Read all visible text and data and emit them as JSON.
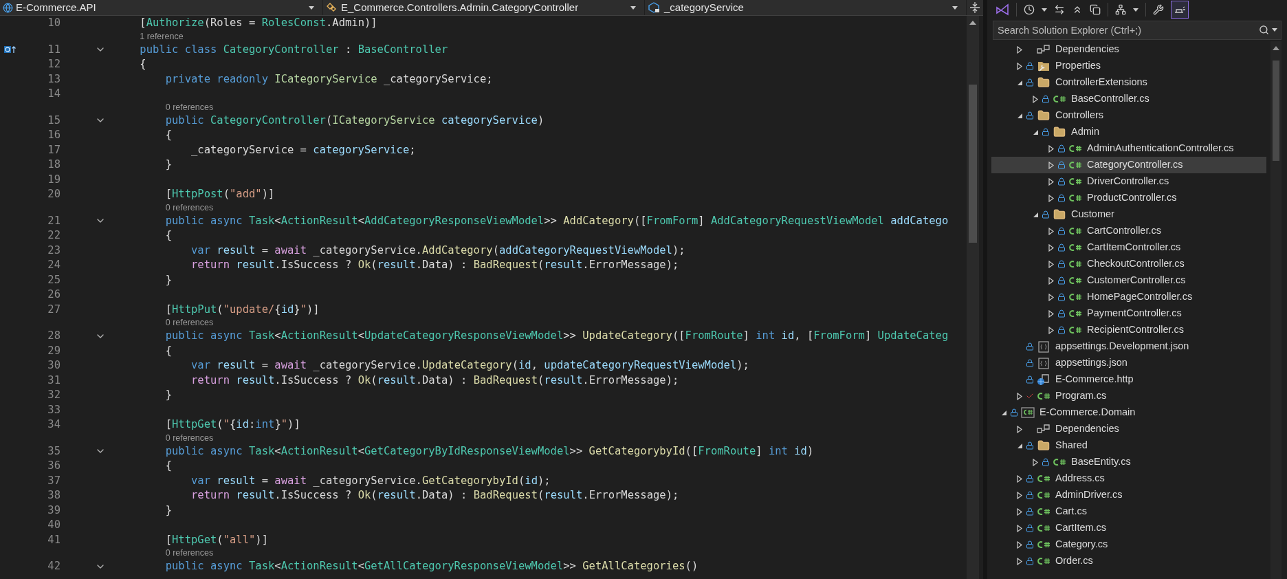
{
  "navigation_bar": [
    {
      "kind": "project",
      "text": "E-Commerce.API"
    },
    {
      "kind": "class",
      "text": "E_Commerce.Controllers.Admin.CategoryController"
    },
    {
      "kind": "member",
      "text": "_categoryService"
    }
  ],
  "editor": {
    "rows": [
      {
        "kind": "code",
        "number": "10",
        "foldable": false,
        "marker": false,
        "tokens": [
          {
            "kind": "plain",
            "text": "    ["
          },
          {
            "kind": "type",
            "text": "Authorize"
          },
          {
            "kind": "plain",
            "text": "(Roles = "
          },
          {
            "kind": "type",
            "text": "RolesConst"
          },
          {
            "kind": "plain",
            "text": ".Admin)]"
          }
        ]
      },
      {
        "kind": "codelens",
        "text": "1 reference"
      },
      {
        "kind": "code",
        "number": "11",
        "foldable": true,
        "marker": true,
        "tokens": [
          {
            "kind": "keyword",
            "text": "    public class "
          },
          {
            "kind": "type",
            "text": "CategoryController"
          },
          {
            "kind": "plain",
            "text": " : "
          },
          {
            "kind": "type",
            "text": "BaseController"
          }
        ]
      },
      {
        "kind": "code",
        "number": "12",
        "foldable": false,
        "marker": false,
        "tokens": [
          {
            "kind": "plain",
            "text": "    {"
          }
        ]
      },
      {
        "kind": "code",
        "number": "13",
        "foldable": false,
        "marker": false,
        "tokens": [
          {
            "kind": "keyword",
            "text": "        private readonly "
          },
          {
            "kind": "interface",
            "text": "ICategoryService"
          },
          {
            "kind": "plain",
            "text": " _categoryService;"
          }
        ]
      },
      {
        "kind": "code",
        "number": "14",
        "foldable": false,
        "marker": false
      },
      {
        "kind": "codelens",
        "text": "0 references"
      },
      {
        "kind": "code",
        "number": "15",
        "foldable": true,
        "marker": false,
        "tokens": [
          {
            "kind": "keyword",
            "text": "        public "
          },
          {
            "kind": "type",
            "text": "CategoryController"
          },
          {
            "kind": "plain",
            "text": "("
          },
          {
            "kind": "interface",
            "text": "ICategoryService"
          },
          {
            "kind": "variable",
            "text": " categoryService"
          },
          {
            "kind": "plain",
            "text": ")"
          }
        ]
      },
      {
        "kind": "code",
        "number": "16",
        "foldable": false,
        "marker": false,
        "tokens": [
          {
            "kind": "plain",
            "text": "        {"
          }
        ]
      },
      {
        "kind": "code",
        "number": "17",
        "foldable": false,
        "marker": false,
        "tokens": [
          {
            "kind": "plain",
            "text": "            _categoryService = "
          },
          {
            "kind": "variable",
            "text": "categoryService"
          },
          {
            "kind": "plain",
            "text": ";"
          }
        ]
      },
      {
        "kind": "code",
        "number": "18",
        "foldable": false,
        "marker": false,
        "tokens": [
          {
            "kind": "plain",
            "text": "        }"
          }
        ]
      },
      {
        "kind": "code",
        "number": "19",
        "foldable": false,
        "marker": false
      },
      {
        "kind": "code",
        "number": "20",
        "foldable": false,
        "marker": false,
        "tokens": [
          {
            "kind": "plain",
            "text": "        ["
          },
          {
            "kind": "type",
            "text": "HttpPost"
          },
          {
            "kind": "plain",
            "text": "("
          },
          {
            "kind": "string",
            "text": "\"add\""
          },
          {
            "kind": "plain",
            "text": ")]"
          }
        ]
      },
      {
        "kind": "codelens",
        "text": "0 references"
      },
      {
        "kind": "code",
        "number": "21",
        "foldable": true,
        "marker": false,
        "tokens": [
          {
            "kind": "keyword",
            "text": "        public async "
          },
          {
            "kind": "type",
            "text": "Task"
          },
          {
            "kind": "plain",
            "text": "<"
          },
          {
            "kind": "type",
            "text": "ActionResult"
          },
          {
            "kind": "plain",
            "text": "<"
          },
          {
            "kind": "type",
            "text": "AddCategoryResponseViewModel"
          },
          {
            "kind": "plain",
            "text": ">> "
          },
          {
            "kind": "method",
            "text": "AddCategory"
          },
          {
            "kind": "plain",
            "text": "(["
          },
          {
            "kind": "type",
            "text": "FromForm"
          },
          {
            "kind": "plain",
            "text": "] "
          },
          {
            "kind": "type",
            "text": "AddCategoryRequestViewModel"
          },
          {
            "kind": "variable",
            "text": " addCatego"
          }
        ]
      },
      {
        "kind": "code",
        "number": "22",
        "foldable": false,
        "marker": false,
        "tokens": [
          {
            "kind": "plain",
            "text": "        {"
          }
        ]
      },
      {
        "kind": "code",
        "number": "23",
        "foldable": false,
        "marker": false,
        "tokens": [
          {
            "kind": "keyword",
            "text": "            var "
          },
          {
            "kind": "variable",
            "text": "result"
          },
          {
            "kind": "plain",
            "text": " = "
          },
          {
            "kind": "control",
            "text": "await"
          },
          {
            "kind": "plain",
            "text": " _categoryService."
          },
          {
            "kind": "method",
            "text": "AddCategory"
          },
          {
            "kind": "plain",
            "text": "("
          },
          {
            "kind": "variable",
            "text": "addCategoryRequestViewModel"
          },
          {
            "kind": "plain",
            "text": ");"
          }
        ]
      },
      {
        "kind": "code",
        "number": "24",
        "foldable": false,
        "marker": false,
        "tokens": [
          {
            "kind": "control",
            "text": "            return "
          },
          {
            "kind": "variable",
            "text": "result"
          },
          {
            "kind": "plain",
            "text": ".IsSuccess ? "
          },
          {
            "kind": "method",
            "text": "Ok"
          },
          {
            "kind": "plain",
            "text": "("
          },
          {
            "kind": "variable",
            "text": "result"
          },
          {
            "kind": "plain",
            "text": ".Data) : "
          },
          {
            "kind": "method",
            "text": "BadRequest"
          },
          {
            "kind": "plain",
            "text": "("
          },
          {
            "kind": "variable",
            "text": "result"
          },
          {
            "kind": "plain",
            "text": ".ErrorMessage);"
          }
        ]
      },
      {
        "kind": "code",
        "number": "25",
        "foldable": false,
        "marker": false,
        "tokens": [
          {
            "kind": "plain",
            "text": "        }"
          }
        ]
      },
      {
        "kind": "code",
        "number": "26",
        "foldable": false,
        "marker": false
      },
      {
        "kind": "code",
        "number": "27",
        "foldable": false,
        "marker": false,
        "tokens": [
          {
            "kind": "plain",
            "text": "        ["
          },
          {
            "kind": "type",
            "text": "HttpPut"
          },
          {
            "kind": "plain",
            "text": "("
          },
          {
            "kind": "string",
            "text": "\"update/"
          },
          {
            "kind": "plain",
            "text": "{"
          },
          {
            "kind": "variable",
            "text": "id"
          },
          {
            "kind": "plain",
            "text": "}"
          },
          {
            "kind": "string",
            "text": "\""
          },
          {
            "kind": "plain",
            "text": ")]"
          }
        ]
      },
      {
        "kind": "codelens",
        "text": "0 references"
      },
      {
        "kind": "code",
        "number": "28",
        "foldable": true,
        "marker": false,
        "tokens": [
          {
            "kind": "keyword",
            "text": "        public async "
          },
          {
            "kind": "type",
            "text": "Task"
          },
          {
            "kind": "plain",
            "text": "<"
          },
          {
            "kind": "type",
            "text": "ActionResult"
          },
          {
            "kind": "plain",
            "text": "<"
          },
          {
            "kind": "type",
            "text": "UpdateCategoryResponseViewModel"
          },
          {
            "kind": "plain",
            "text": ">> "
          },
          {
            "kind": "method",
            "text": "UpdateCategory"
          },
          {
            "kind": "plain",
            "text": "(["
          },
          {
            "kind": "type",
            "text": "FromRoute"
          },
          {
            "kind": "plain",
            "text": "] "
          },
          {
            "kind": "keyword",
            "text": "int "
          },
          {
            "kind": "variable",
            "text": "id"
          },
          {
            "kind": "plain",
            "text": ", ["
          },
          {
            "kind": "type",
            "text": "FromForm"
          },
          {
            "kind": "plain",
            "text": "] "
          },
          {
            "kind": "type",
            "text": "UpdateCateg"
          }
        ]
      },
      {
        "kind": "code",
        "number": "29",
        "foldable": false,
        "marker": false,
        "tokens": [
          {
            "kind": "plain",
            "text": "        {"
          }
        ]
      },
      {
        "kind": "code",
        "number": "30",
        "foldable": false,
        "marker": false,
        "tokens": [
          {
            "kind": "keyword",
            "text": "            var "
          },
          {
            "kind": "variable",
            "text": "result"
          },
          {
            "kind": "plain",
            "text": " = "
          },
          {
            "kind": "control",
            "text": "await"
          },
          {
            "kind": "plain",
            "text": " _categoryService."
          },
          {
            "kind": "method",
            "text": "UpdateCategory"
          },
          {
            "kind": "plain",
            "text": "("
          },
          {
            "kind": "variable",
            "text": "id"
          },
          {
            "kind": "plain",
            "text": ", "
          },
          {
            "kind": "variable",
            "text": "updateCategoryRequestViewModel"
          },
          {
            "kind": "plain",
            "text": ");"
          }
        ]
      },
      {
        "kind": "code",
        "number": "31",
        "foldable": false,
        "marker": false,
        "tokens": [
          {
            "kind": "control",
            "text": "            return "
          },
          {
            "kind": "variable",
            "text": "result"
          },
          {
            "kind": "plain",
            "text": ".IsSuccess ? "
          },
          {
            "kind": "method",
            "text": "Ok"
          },
          {
            "kind": "plain",
            "text": "("
          },
          {
            "kind": "variable",
            "text": "result"
          },
          {
            "kind": "plain",
            "text": ".Data) : "
          },
          {
            "kind": "method",
            "text": "BadRequest"
          },
          {
            "kind": "plain",
            "text": "("
          },
          {
            "kind": "variable",
            "text": "result"
          },
          {
            "kind": "plain",
            "text": ".ErrorMessage);"
          }
        ]
      },
      {
        "kind": "code",
        "number": "32",
        "foldable": false,
        "marker": false,
        "tokens": [
          {
            "kind": "plain",
            "text": "        }"
          }
        ]
      },
      {
        "kind": "code",
        "number": "33",
        "foldable": false,
        "marker": false
      },
      {
        "kind": "code",
        "number": "34",
        "foldable": false,
        "marker": false,
        "tokens": [
          {
            "kind": "plain",
            "text": "        ["
          },
          {
            "kind": "type",
            "text": "HttpGet"
          },
          {
            "kind": "plain",
            "text": "("
          },
          {
            "kind": "string",
            "text": "\""
          },
          {
            "kind": "plain",
            "text": "{"
          },
          {
            "kind": "variable",
            "text": "id"
          },
          {
            "kind": "plain",
            "text": ":"
          },
          {
            "kind": "keyword",
            "text": "int"
          },
          {
            "kind": "plain",
            "text": "}"
          },
          {
            "kind": "string",
            "text": "\""
          },
          {
            "kind": "plain",
            "text": ")]"
          }
        ]
      },
      {
        "kind": "codelens",
        "text": "0 references"
      },
      {
        "kind": "code",
        "number": "35",
        "foldable": true,
        "marker": false,
        "tokens": [
          {
            "kind": "keyword",
            "text": "        public async "
          },
          {
            "kind": "type",
            "text": "Task"
          },
          {
            "kind": "plain",
            "text": "<"
          },
          {
            "kind": "type",
            "text": "ActionResult"
          },
          {
            "kind": "plain",
            "text": "<"
          },
          {
            "kind": "type",
            "text": "GetCategoryByIdResponseViewModel"
          },
          {
            "kind": "plain",
            "text": ">> "
          },
          {
            "kind": "method",
            "text": "GetCategorybyId"
          },
          {
            "kind": "plain",
            "text": "(["
          },
          {
            "kind": "type",
            "text": "FromRoute"
          },
          {
            "kind": "plain",
            "text": "] "
          },
          {
            "kind": "keyword",
            "text": "int "
          },
          {
            "kind": "variable",
            "text": "id"
          },
          {
            "kind": "plain",
            "text": ")"
          }
        ]
      },
      {
        "kind": "code",
        "number": "36",
        "foldable": false,
        "marker": false,
        "tokens": [
          {
            "kind": "plain",
            "text": "        {"
          }
        ]
      },
      {
        "kind": "code",
        "number": "37",
        "foldable": false,
        "marker": false,
        "tokens": [
          {
            "kind": "keyword",
            "text": "            var "
          },
          {
            "kind": "variable",
            "text": "result"
          },
          {
            "kind": "plain",
            "text": " = "
          },
          {
            "kind": "control",
            "text": "await"
          },
          {
            "kind": "plain",
            "text": " _categoryService."
          },
          {
            "kind": "method",
            "text": "GetCategorybyId"
          },
          {
            "kind": "plain",
            "text": "("
          },
          {
            "kind": "variable",
            "text": "id"
          },
          {
            "kind": "plain",
            "text": ");"
          }
        ]
      },
      {
        "kind": "code",
        "number": "38",
        "foldable": false,
        "marker": false,
        "tokens": [
          {
            "kind": "control",
            "text": "            return "
          },
          {
            "kind": "variable",
            "text": "result"
          },
          {
            "kind": "plain",
            "text": ".IsSuccess ? "
          },
          {
            "kind": "method",
            "text": "Ok"
          },
          {
            "kind": "plain",
            "text": "("
          },
          {
            "kind": "variable",
            "text": "result"
          },
          {
            "kind": "plain",
            "text": ".Data) : "
          },
          {
            "kind": "method",
            "text": "BadRequest"
          },
          {
            "kind": "plain",
            "text": "("
          },
          {
            "kind": "variable",
            "text": "result"
          },
          {
            "kind": "plain",
            "text": ".ErrorMessage);"
          }
        ]
      },
      {
        "kind": "code",
        "number": "39",
        "foldable": false,
        "marker": false,
        "tokens": [
          {
            "kind": "plain",
            "text": "        }"
          }
        ]
      },
      {
        "kind": "code",
        "number": "40",
        "foldable": false,
        "marker": false
      },
      {
        "kind": "code",
        "number": "41",
        "foldable": false,
        "marker": false,
        "tokens": [
          {
            "kind": "plain",
            "text": "        ["
          },
          {
            "kind": "type",
            "text": "HttpGet"
          },
          {
            "kind": "plain",
            "text": "("
          },
          {
            "kind": "string",
            "text": "\"all\""
          },
          {
            "kind": "plain",
            "text": ")]"
          }
        ]
      },
      {
        "kind": "codelens",
        "text": "0 references"
      },
      {
        "kind": "code",
        "number": "42",
        "foldable": true,
        "marker": false,
        "tokens": [
          {
            "kind": "keyword",
            "text": "        public async "
          },
          {
            "kind": "type",
            "text": "Task"
          },
          {
            "kind": "plain",
            "text": "<"
          },
          {
            "kind": "type",
            "text": "ActionResult"
          },
          {
            "kind": "plain",
            "text": "<"
          },
          {
            "kind": "type",
            "text": "GetAllCategoryResponseViewModel"
          },
          {
            "kind": "plain",
            "text": ">> "
          },
          {
            "kind": "method",
            "text": "GetAllCategories"
          },
          {
            "kind": "plain",
            "text": "()"
          }
        ]
      }
    ]
  },
  "solution_explorer": {
    "preview_toggle_on": true,
    "search": {
      "placeholder": "Search Solution Explorer (Ctrl+;)"
    },
    "tree": [
      {
        "children": [
          {
            "label": "Dependencies",
            "kind": "dependencies",
            "locked": false,
            "edited": false,
            "expandable": true,
            "expanded": false,
            "selected": false
          },
          {
            "label": "Properties",
            "kind": "properties",
            "locked": true,
            "edited": false,
            "expandable": true,
            "expanded": false,
            "selected": false
          },
          {
            "label": "ControllerExtensions",
            "kind": "folder",
            "locked": true,
            "edited": false,
            "expandable": true,
            "expanded": true,
            "selected": false,
            "children": [
              {
                "label": "BaseController.cs",
                "kind": "csharp",
                "locked": true,
                "edited": false,
                "expandable": true,
                "expanded": false,
                "selected": false
              }
            ]
          },
          {
            "label": "Controllers",
            "kind": "folder",
            "locked": true,
            "edited": false,
            "expandable": true,
            "expanded": true,
            "selected": false,
            "children": [
              {
                "label": "Admin",
                "kind": "folder",
                "locked": true,
                "edited": false,
                "expandable": true,
                "expanded": true,
                "selected": false,
                "children": [
                  {
                    "label": "AdminAuthenticationController.cs",
                    "kind": "csharp",
                    "locked": true,
                    "edited": false,
                    "expandable": true,
                    "expanded": false,
                    "selected": false
                  },
                  {
                    "label": "CategoryController.cs",
                    "kind": "csharp",
                    "locked": true,
                    "edited": false,
                    "expandable": true,
                    "expanded": false,
                    "selected": true
                  },
                  {
                    "label": "DriverController.cs",
                    "kind": "csharp",
                    "locked": true,
                    "edited": false,
                    "expandable": true,
                    "expanded": false,
                    "selected": false
                  },
                  {
                    "label": "ProductController.cs",
                    "kind": "csharp",
                    "locked": true,
                    "edited": false,
                    "expandable": true,
                    "expanded": false,
                    "selected": false
                  }
                ]
              },
              {
                "label": "Customer",
                "kind": "folder",
                "locked": true,
                "edited": false,
                "expandable": true,
                "expanded": true,
                "selected": false,
                "children": [
                  {
                    "label": "CartController.cs",
                    "kind": "csharp",
                    "locked": true,
                    "edited": false,
                    "expandable": true,
                    "expanded": false,
                    "selected": false
                  },
                  {
                    "label": "CartItemController.cs",
                    "kind": "csharp",
                    "locked": true,
                    "edited": false,
                    "expandable": true,
                    "expanded": false,
                    "selected": false
                  },
                  {
                    "label": "CheckoutController.cs",
                    "kind": "csharp",
                    "locked": true,
                    "edited": false,
                    "expandable": true,
                    "expanded": false,
                    "selected": false
                  },
                  {
                    "label": "CustomerController.cs",
                    "kind": "csharp",
                    "locked": true,
                    "edited": false,
                    "expandable": true,
                    "expanded": false,
                    "selected": false
                  },
                  {
                    "label": "HomePageController.cs",
                    "kind": "csharp",
                    "locked": true,
                    "edited": false,
                    "expandable": true,
                    "expanded": false,
                    "selected": false
                  },
                  {
                    "label": "PaymentController.cs",
                    "kind": "csharp",
                    "locked": true,
                    "edited": false,
                    "expandable": true,
                    "expanded": false,
                    "selected": false
                  },
                  {
                    "label": "RecipientController.cs",
                    "kind": "csharp",
                    "locked": true,
                    "edited": false,
                    "expandable": true,
                    "expanded": false,
                    "selected": false
                  }
                ]
              }
            ]
          },
          {
            "label": "appsettings.Development.json",
            "kind": "json",
            "locked": true,
            "edited": false,
            "expandable": false,
            "selected": false
          },
          {
            "label": "appsettings.json",
            "kind": "json",
            "locked": true,
            "edited": false,
            "expandable": false,
            "selected": false
          },
          {
            "label": "E-Commerce.http",
            "kind": "http",
            "locked": true,
            "edited": false,
            "expandable": false,
            "selected": false
          },
          {
            "label": "Program.cs",
            "kind": "csharp",
            "locked": false,
            "edited": true,
            "expandable": true,
            "expanded": false,
            "selected": false
          }
        ]
      },
      {
        "label": "E-Commerce.Domain",
        "kind": "project",
        "locked": true,
        "edited": false,
        "expandable": true,
        "expanded": true,
        "selected": false,
        "children": [
          {
            "label": "Dependencies",
            "kind": "dependencies",
            "locked": false,
            "edited": false,
            "expandable": true,
            "expanded": false,
            "selected": false
          },
          {
            "label": "Shared",
            "kind": "folder",
            "locked": true,
            "edited": false,
            "expandable": true,
            "expanded": true,
            "selected": false,
            "children": [
              {
                "label": "BaseEntity.cs",
                "kind": "csharp",
                "locked": true,
                "edited": false,
                "expandable": true,
                "expanded": false,
                "selected": false
              }
            ]
          },
          {
            "label": "Address.cs",
            "kind": "csharp",
            "locked": true,
            "edited": false,
            "expandable": true,
            "expanded": false,
            "selected": false
          },
          {
            "label": "AdminDriver.cs",
            "kind": "csharp",
            "locked": true,
            "edited": false,
            "expandable": true,
            "expanded": false,
            "selected": false
          },
          {
            "label": "Cart.cs",
            "kind": "csharp",
            "locked": true,
            "edited": false,
            "expandable": true,
            "expanded": false,
            "selected": false
          },
          {
            "label": "CartItem.cs",
            "kind": "csharp",
            "locked": true,
            "edited": false,
            "expandable": true,
            "expanded": false,
            "selected": false
          },
          {
            "label": "Category.cs",
            "kind": "csharp",
            "locked": true,
            "edited": false,
            "expandable": true,
            "expanded": false,
            "selected": false
          },
          {
            "label": "Order.cs",
            "kind": "csharp",
            "locked": true,
            "edited": false,
            "expandable": true,
            "expanded": false,
            "selected": false
          }
        ]
      }
    ]
  }
}
